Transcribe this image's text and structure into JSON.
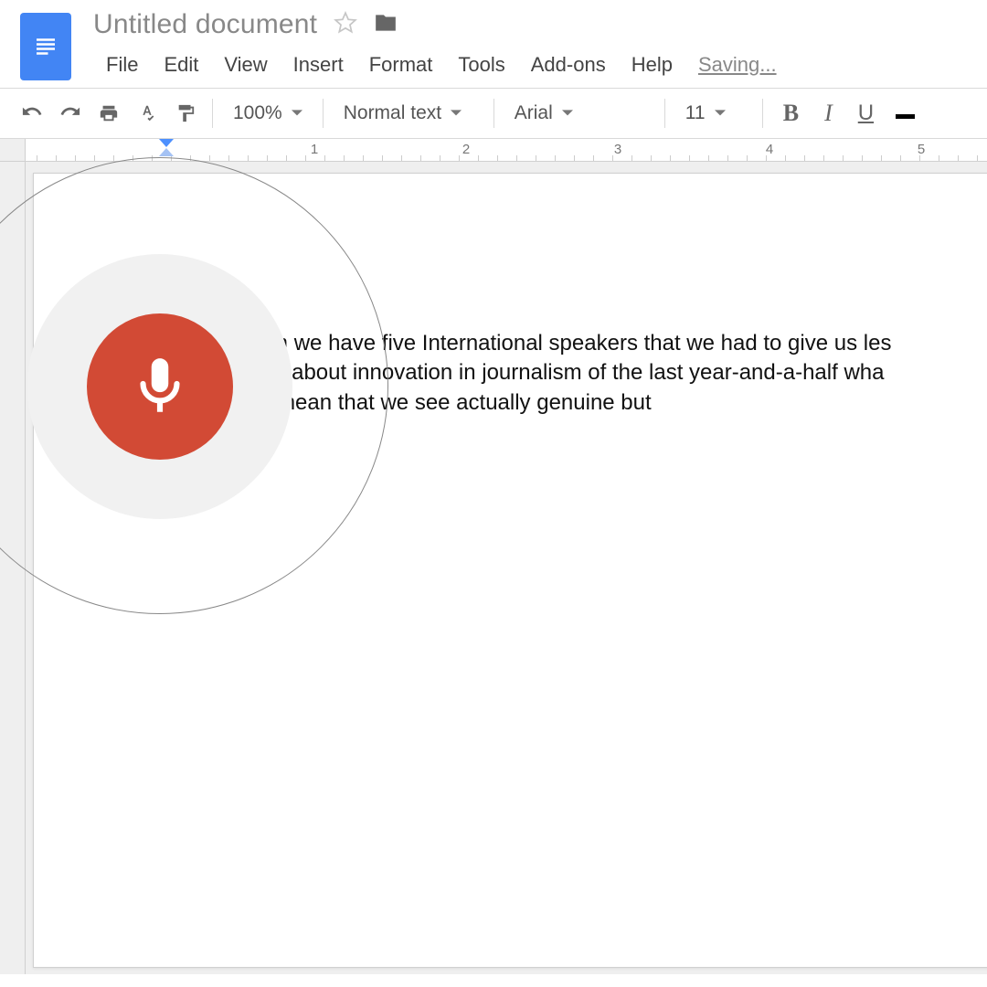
{
  "header": {
    "title": "Untitled document",
    "menus": [
      "File",
      "Edit",
      "View",
      "Insert",
      "Format",
      "Tools",
      "Add-ons",
      "Help"
    ],
    "status": "Saving..."
  },
  "toolbar": {
    "zoom": "100%",
    "style": "Normal text",
    "font": "Arial",
    "size": "11"
  },
  "ruler": {
    "marks": [
      "1",
      "2",
      "3",
      "4",
      "5"
    ]
  },
  "document": {
    "line1": "ation Forum we have five International speakers that we had to give us les",
    "line2": "hey learned about innovation in journalism of the last year-and-a-half wha",
    "line3": "increasing mean that we see actually genuine but"
  }
}
